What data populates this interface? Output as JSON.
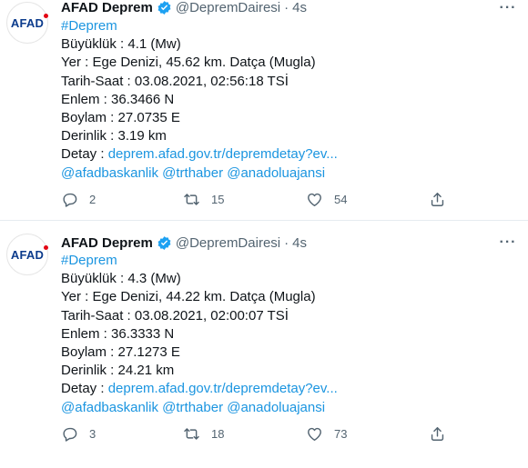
{
  "tweets": [
    {
      "author": "AFAD Deprem",
      "handle": "@DepremDairesi",
      "separator": "·",
      "time": "4s",
      "avatar_text": "AFAD",
      "hashtag": "#Deprem",
      "magnitude": "Büyüklük : 4.1 (Mw)",
      "location": "Yer : Ege Denizi, 45.62 km. Datça (Mugla)",
      "datetime": "Tarih-Saat : 03.08.2021, 02:56:18 TSİ",
      "latitude": "Enlem : 36.3466 N",
      "longitude": "Boylam : 27.0735 E",
      "depth": "Derinlik : 3.19 km",
      "detail_label": "Detay : ",
      "detail_link": "deprem.afad.gov.tr/depremdetay?ev...",
      "mentions": [
        "@afadbaskanlik",
        "@trthaber",
        "@anadoluajansi"
      ],
      "replies": "2",
      "retweets": "15",
      "likes": "54"
    },
    {
      "author": "AFAD Deprem",
      "handle": "@DepremDairesi",
      "separator": "·",
      "time": "4s",
      "avatar_text": "AFAD",
      "hashtag": "#Deprem",
      "magnitude": "Büyüklük : 4.3 (Mw)",
      "location": "Yer : Ege Denizi, 44.22 km. Datça (Mugla)",
      "datetime": "Tarih-Saat : 03.08.2021, 02:00:07 TSİ",
      "latitude": "Enlem : 36.3333 N",
      "longitude": "Boylam : 27.1273 E",
      "depth": "Derinlik : 24.21 km",
      "detail_label": "Detay : ",
      "detail_link": "deprem.afad.gov.tr/depremdetay?ev...",
      "mentions": [
        "@afadbaskanlik",
        "@trthaber",
        "@anadoluajansi"
      ],
      "replies": "3",
      "retweets": "18",
      "likes": "73"
    }
  ],
  "icons": {
    "verified": "verified-badge-icon",
    "more": "more-options-icon",
    "reply": "reply-icon",
    "retweet": "retweet-icon",
    "like": "heart-icon",
    "share": "share-icon"
  },
  "colors": {
    "link": "#1b95e0",
    "secondary_text": "#536471",
    "verified": "#1da1f2",
    "logo_blue": "#0b3b8c",
    "logo_red": "#e30613"
  }
}
